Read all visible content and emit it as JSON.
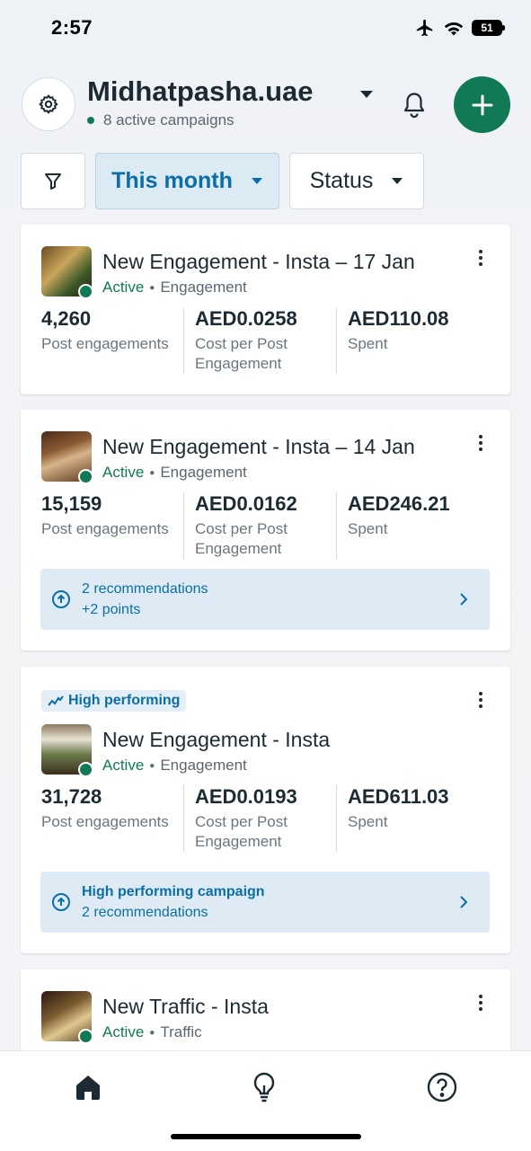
{
  "status_bar": {
    "time": "2:57",
    "battery": "51"
  },
  "header": {
    "account_name": "Midhatpasha.uae",
    "subtitle": "8 active campaigns"
  },
  "filters": {
    "period_label": "This month",
    "status_label": "Status"
  },
  "campaigns": [
    {
      "title": "New Engagement - Insta – 17 Jan",
      "status": "Active",
      "objective": "Engagement",
      "metrics": [
        {
          "value": "4,260",
          "label": "Post engagements"
        },
        {
          "value": "AED0.0258",
          "label": "Cost per Post Engagement"
        },
        {
          "value": "AED110.08",
          "label": "Spent"
        }
      ]
    },
    {
      "title": "New Engagement - Insta – 14 Jan",
      "status": "Active",
      "objective": "Engagement",
      "metrics": [
        {
          "value": "15,159",
          "label": "Post engagements"
        },
        {
          "value": "AED0.0162",
          "label": "Cost per Post Engagement"
        },
        {
          "value": "AED246.21",
          "label": "Spent"
        }
      ],
      "recommendation": {
        "line1": "2 recommendations",
        "line2": "+2 points"
      }
    },
    {
      "badge": "High performing",
      "title": "New Engagement - Insta",
      "status": "Active",
      "objective": "Engagement",
      "metrics": [
        {
          "value": "31,728",
          "label": "Post engagements"
        },
        {
          "value": "AED0.0193",
          "label": "Cost per Post Engagement"
        },
        {
          "value": "AED611.03",
          "label": "Spent"
        }
      ],
      "recommendation": {
        "line1": "High performing campaign",
        "line2": "2 recommendations"
      }
    },
    {
      "title": "New Traffic - Insta",
      "status": "Active",
      "objective": "Traffic"
    }
  ],
  "colors": {
    "brand_green": "#117a55",
    "link_blue": "#0b6ea6"
  },
  "bottom_nav": {
    "items": [
      "home-icon",
      "lightbulb-icon",
      "help-icon"
    ]
  }
}
